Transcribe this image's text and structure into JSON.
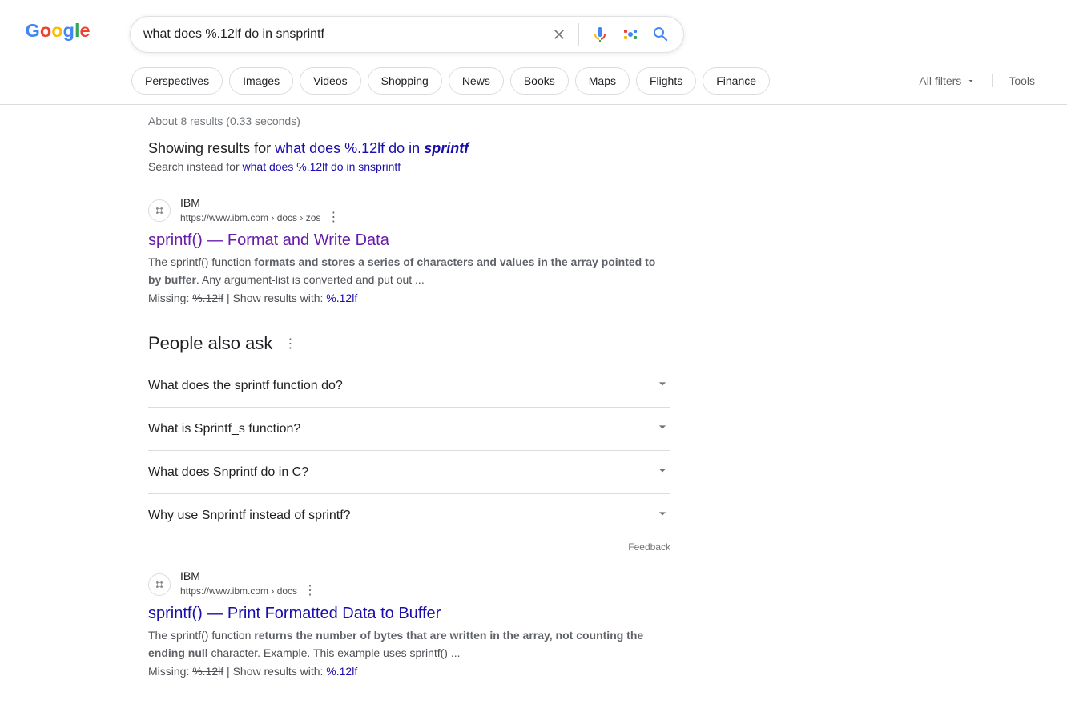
{
  "search": {
    "query": "what does %.12lf do in snsprintf"
  },
  "tabs": [
    "Perspectives",
    "Images",
    "Videos",
    "Shopping",
    "News",
    "Books",
    "Maps",
    "Flights",
    "Finance"
  ],
  "filters": {
    "label": "All filters",
    "tools": "Tools"
  },
  "stats": "About 8 results (0.33 seconds)",
  "spell": {
    "prefix": "Showing results for ",
    "corrected_pre": "what does %.12lf do in ",
    "corrected_bold": "sprintf",
    "instead_prefix": "Search instead for ",
    "instead_link": "what does %.12lf do in snsprintf"
  },
  "results": [
    {
      "site": "IBM",
      "url": "https://www.ibm.com › docs › zos",
      "title": "sprintf() — Format and Write Data",
      "visited": true,
      "snippet_pre": "The sprintf() function ",
      "snippet_bold": "formats and stores a series of characters and values in the array pointed to by buffer",
      "snippet_post": ". Any argument-list is converted and put out ...",
      "missing_label": "Missing: ",
      "missing_term": "%.12lf",
      "show_label": " | Show results with: ",
      "show_term": "%.12lf"
    },
    {
      "site": "IBM",
      "url": "https://www.ibm.com › docs",
      "title": "sprintf() — Print Formatted Data to Buffer",
      "visited": false,
      "snippet_pre": "The sprintf() function ",
      "snippet_bold": "returns the number of bytes that are written in the array, not counting the ending null",
      "snippet_post": " character. Example. This example uses sprintf() ...",
      "missing_label": "Missing: ",
      "missing_term": "%.12lf",
      "show_label": " | Show results with: ",
      "show_term": "%.12lf"
    }
  ],
  "paa": {
    "title": "People also ask",
    "items": [
      "What does the sprintf function do?",
      "What is Sprintf_s function?",
      "What does Snprintf do in C?",
      "Why use Snprintf instead of sprintf?"
    ],
    "feedback": "Feedback"
  }
}
